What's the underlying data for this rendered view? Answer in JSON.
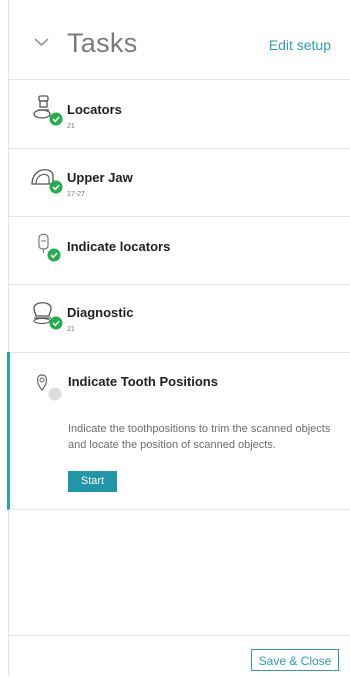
{
  "header": {
    "title": "Tasks",
    "edit_label": "Edit setup"
  },
  "tasks": [
    {
      "label": "Locators",
      "sub": "21",
      "icon": "locator-implant-icon",
      "status": "done"
    },
    {
      "label": "Upper Jaw",
      "sub": "17-27",
      "icon": "upper-jaw-icon",
      "status": "done"
    },
    {
      "label": "Indicate locators",
      "sub": "",
      "icon": "indicate-locators-icon",
      "status": "done"
    },
    {
      "label": "Diagnostic",
      "sub": "21",
      "icon": "diagnostic-tooth-icon",
      "status": "done"
    },
    {
      "label": "Indicate Tooth Positions",
      "sub": "",
      "icon": "tooth-position-pin-icon",
      "status": "pending",
      "description": "Indicate the toothpositions to trim the scanned objects and locate the position of scanned objects.",
      "action_label": "Start"
    }
  ],
  "footer": {
    "save_label": "Save & Close"
  },
  "colors": {
    "accent": "#2b9fb4",
    "check": "#1fae4b",
    "pending": "#dcdcdc"
  }
}
